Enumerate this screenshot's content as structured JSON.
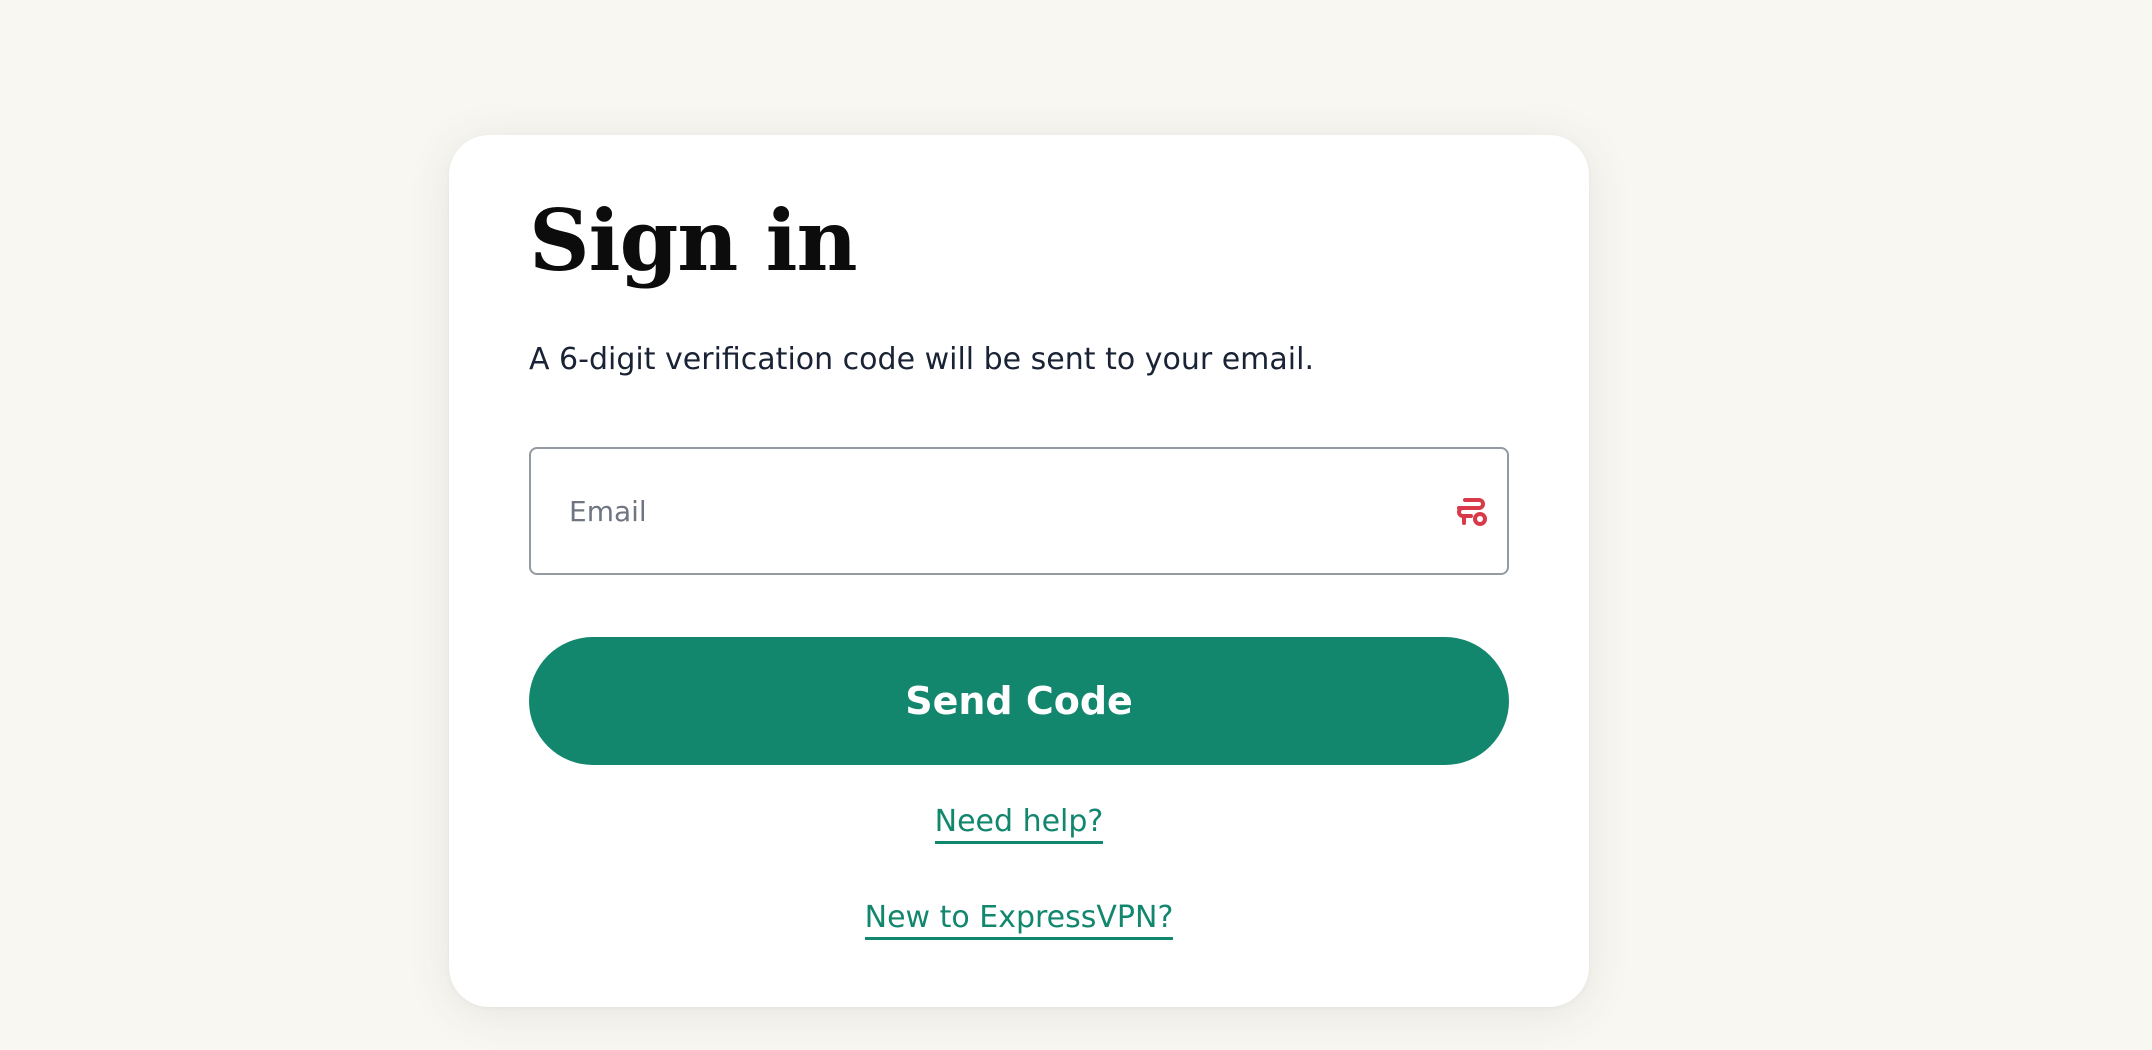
{
  "signin": {
    "title": "Sign in",
    "subtitle": "A 6-digit verification code will be sent to your email.",
    "email": {
      "placeholder": "Email",
      "value": ""
    },
    "field_icon": "password-manager-key-icon",
    "send_button_label": "Send Code",
    "need_help_link": "Need help?",
    "new_user_link": "New to ExpressVPN?"
  },
  "colors": {
    "page_background": "#f8f7f2",
    "card_background": "#ffffff",
    "accent": "#13876e",
    "field_icon": "#d83a4a",
    "field_border": "#939aa1"
  }
}
